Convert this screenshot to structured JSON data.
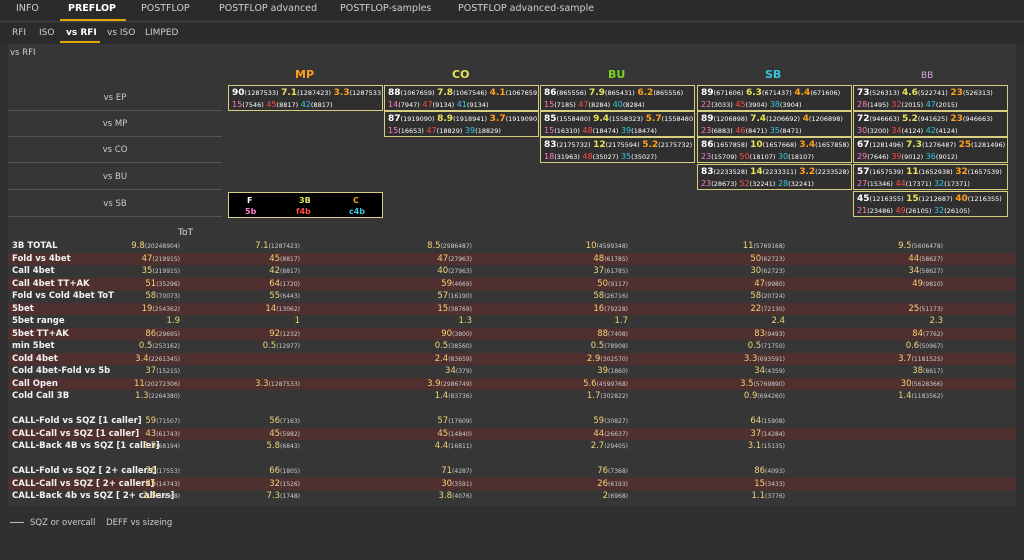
{
  "tabs": [
    "INFO",
    "PREFLOP",
    "POSTFLOP",
    "POSTFLOP advanced",
    "POSTFLOP-samples",
    "POSTFLOP advanced-sample"
  ],
  "active_tab": "PREFLOP",
  "subtabs": [
    "RFI",
    "ISO",
    "vs RFI",
    "vs ISO",
    "LIMPED"
  ],
  "active_subtab": "vs RFI",
  "panel_title": "vs RFI",
  "positions": [
    {
      "label": "MP",
      "color": "#ff9f1a"
    },
    {
      "label": "CO",
      "color": "#e8e35a"
    },
    {
      "label": "BU",
      "color": "#7ed321"
    },
    {
      "label": "SB",
      "color": "#35c6e0"
    },
    {
      "label": "BB",
      "color": "#d9a0e0"
    }
  ],
  "row_labels": [
    "vs EP",
    "vs MP",
    "vs CO",
    "vs BU",
    "vs SB"
  ],
  "matrix": [
    [
      [
        "90",
        "(1287533)",
        "7.1",
        "(1287423)",
        "3.3",
        "(1287533)",
        "15",
        "(7546)",
        "45",
        "(8817)",
        "42",
        "(8817)"
      ],
      [
        "88",
        "(1067659)",
        "7.8",
        "(1067546)",
        "4.1",
        "(1067659)",
        "14",
        "(7947)",
        "47",
        "(9134)",
        "41",
        "(9134)"
      ],
      [
        "86",
        "(865556)",
        "7.9",
        "(865431)",
        "6.2",
        "(865556)",
        "15",
        "(7185)",
        "47",
        "(8284)",
        "40",
        "(8284)"
      ],
      [
        "89",
        "(671606)",
        "6.3",
        "(671437)",
        "4.4",
        "(671606)",
        "22",
        "(3033)",
        "45",
        "(3904)",
        "38",
        "(3904)"
      ],
      [
        "73",
        "(526313)",
        "4.6",
        "(522741)",
        "23",
        "(526313)",
        "28",
        "(1495)",
        "32",
        "(2015)",
        "47",
        "(2015)"
      ]
    ],
    [
      null,
      [
        "87",
        "(1919090)",
        "8.9",
        "(1918941)",
        "3.7",
        "(1919090)",
        "15",
        "(16653)",
        "47",
        "(18829)",
        "39",
        "(18829)"
      ],
      [
        "85",
        "(1558480)",
        "9.4",
        "(1558323)",
        "5.7",
        "(1558480)",
        "15",
        "(16310)",
        "48",
        "(18474)",
        "39",
        "(18474)"
      ],
      [
        "89",
        "(1206898)",
        "7.4",
        "(1206692)",
        "4",
        "(1206898)",
        "23",
        "(6883)",
        "46",
        "(8471)",
        "35",
        "(8471)"
      ],
      [
        "72",
        "(946663)",
        "5.2",
        "(941625)",
        "23",
        "(946663)",
        "30",
        "(3200)",
        "34",
        "(4124)",
        "42",
        "(4124)"
      ]
    ],
    [
      null,
      null,
      [
        "83",
        "(2175732)",
        "12",
        "(2175594)",
        "5.2",
        "(2175732)",
        "18",
        "(31963)",
        "48",
        "(35027)",
        "35",
        "(35027)"
      ],
      [
        "86",
        "(1657858)",
        "10",
        "(1657668)",
        "3.4",
        "(1657858)",
        "23",
        "(15709)",
        "50",
        "(18107)",
        "30",
        "(18107)"
      ],
      [
        "67",
        "(1281496)",
        "7.3",
        "(1276487)",
        "25",
        "(1281496)",
        "29",
        "(7646)",
        "39",
        "(9012)",
        "36",
        "(9012)"
      ]
    ],
    [
      null,
      null,
      null,
      [
        "83",
        "(2233528)",
        "14",
        "(2233311)",
        "3.2",
        "(2233528)",
        "23",
        "(28673)",
        "52",
        "(32241)",
        "28",
        "(32241)"
      ],
      [
        "57",
        "(1657539)",
        "11",
        "(1652938)",
        "32",
        "(1657539)",
        "27",
        "(15346)",
        "44",
        "(17371)",
        "32",
        "(17371)"
      ]
    ],
    [
      null,
      null,
      null,
      null,
      [
        "45",
        "(1216355)",
        "15",
        "(1212687)",
        "40",
        "(1216355)",
        "21",
        "(23486)",
        "49",
        "(26105)",
        "32",
        "(26105)"
      ]
    ]
  ],
  "legend": {
    "f": "F",
    "b3": "3B",
    "c": "C",
    "b5": "5b",
    "f4b": "f4b",
    "c4b": "c4b"
  },
  "tot_label": "ToT",
  "stats": [
    {
      "label": "3B TOTAL",
      "vals": [
        [
          "9.8",
          "(20248904)"
        ],
        [
          "7.1",
          "(1287423)"
        ],
        [
          "8.5",
          "(2986487)"
        ],
        [
          "10",
          "(4599348)"
        ],
        [
          "11",
          "(5769168)"
        ],
        [
          "9.5",
          "(5606478)"
        ]
      ]
    },
    {
      "label": "Fold vs 4bet",
      "vals": [
        [
          "47",
          "(219915)"
        ],
        [
          "45",
          "(8817)"
        ],
        [
          "47",
          "(27963)"
        ],
        [
          "48",
          "(61785)"
        ],
        [
          "50",
          "(62723)"
        ],
        [
          "44",
          "(58627)"
        ]
      ]
    },
    {
      "label": "Call 4bet",
      "vals": [
        [
          "35",
          "(219915)"
        ],
        [
          "42",
          "(8817)"
        ],
        [
          "40",
          "(27963)"
        ],
        [
          "37",
          "(61785)"
        ],
        [
          "30",
          "(62723)"
        ],
        [
          "34",
          "(58627)"
        ]
      ]
    },
    {
      "label": "Call 4bet TT+AK",
      "vals": [
        [
          "51",
          "(35296)"
        ],
        [
          "64",
          "(1720)"
        ],
        [
          "59",
          "(4669)"
        ],
        [
          "50",
          "(9117)"
        ],
        [
          "47",
          "(9980)"
        ],
        [
          "49",
          "(9810)"
        ]
      ]
    },
    {
      "label": "Fold vs Cold 4bet ToT",
      "vals": [
        [
          "58",
          "(70073)"
        ],
        [
          "55",
          "(6443)"
        ],
        [
          "57",
          "(16190)"
        ],
        [
          "58",
          "(26716)"
        ],
        [
          "58",
          "(20724)"
        ],
        null
      ]
    },
    {
      "label": "5bet",
      "vals": [
        [
          "19",
          "(254362)"
        ],
        [
          "14",
          "(13062)"
        ],
        [
          "15",
          "(38769)"
        ],
        [
          "16",
          "(79228)"
        ],
        [
          "22",
          "(72130)"
        ],
        [
          "25",
          "(51173)"
        ]
      ]
    },
    {
      "label": "5bet range",
      "vals": [
        [
          "1.9",
          ""
        ],
        [
          "1",
          ""
        ],
        [
          "1.3",
          ""
        ],
        [
          "1.7",
          ""
        ],
        [
          "2.4",
          ""
        ],
        [
          "2.3",
          ""
        ]
      ]
    },
    {
      "label": "5bet TT+AK",
      "vals": [
        [
          "86",
          "(29695)"
        ],
        [
          "92",
          "(1232)"
        ],
        [
          "90",
          "(3800)"
        ],
        [
          "88",
          "(7408)"
        ],
        [
          "83",
          "(9493)"
        ],
        [
          "84",
          "(7762)"
        ]
      ]
    },
    {
      "label": "min 5bet",
      "vals": [
        [
          "0.5",
          "(253162)"
        ],
        [
          "0.5",
          "(12977)"
        ],
        [
          "0.5",
          "(38560)"
        ],
        [
          "0.5",
          "(78908)"
        ],
        [
          "0.5",
          "(71750)"
        ],
        [
          "0.6",
          "(50967)"
        ]
      ]
    },
    {
      "label": "Cold 4bet",
      "vals": [
        [
          "3.4",
          "(2261345)"
        ],
        null,
        [
          "2.4",
          "(83659)"
        ],
        [
          "2.9",
          "(302570)"
        ],
        [
          "3.3",
          "(693591)"
        ],
        [
          "3.7",
          "(1181525)"
        ]
      ]
    },
    {
      "label": "Cold 4bet-Fold vs 5b",
      "vals": [
        [
          "37",
          "(15215)"
        ],
        null,
        [
          "34",
          "(379)"
        ],
        [
          "39",
          "(1860)"
        ],
        [
          "34",
          "(4359)"
        ],
        [
          "38",
          "(8617)"
        ]
      ]
    },
    {
      "label": "Call Open",
      "vals": [
        [
          "11",
          "(20272306)"
        ],
        [
          "3.3",
          "(1287533)"
        ],
        [
          "3.9",
          "(2986749)"
        ],
        [
          "5.6",
          "(4599768)"
        ],
        [
          "3.5",
          "(5769890)"
        ],
        [
          "30",
          "(5628366)"
        ]
      ]
    },
    {
      "label": "Cold Call 3B",
      "vals": [
        [
          "1.3",
          "(2264380)"
        ],
        null,
        [
          "1.4",
          "(83736)"
        ],
        [
          "1.7",
          "(302822)"
        ],
        [
          "0.9",
          "(694260)"
        ],
        [
          "1.4",
          "(1183562)"
        ]
      ]
    },
    {
      "label": "",
      "vals": [
        null,
        null,
        null,
        null,
        null,
        null
      ]
    },
    {
      "label": "CALL-Fold vs SQZ [1 caller]",
      "vals": [
        [
          "59",
          "(71507)"
        ],
        [
          "56",
          "(7163)"
        ],
        [
          "57",
          "(17609)"
        ],
        [
          "59",
          "(30827)"
        ],
        [
          "64",
          "(15908)"
        ],
        null
      ]
    },
    {
      "label": "CALL-Call vs SQZ [1 caller]",
      "vals": [
        [
          "43",
          "(61743)"
        ],
        [
          "45",
          "(5982)"
        ],
        [
          "45",
          "(14840)"
        ],
        [
          "44",
          "(26637)"
        ],
        [
          "37",
          "(14284)"
        ],
        null
      ]
    },
    {
      "label": "CALL-Back 4B vs SQZ [1 caller]",
      "vals": [
        [
          "3.5",
          "(68194)"
        ],
        [
          "5.8",
          "(6843)"
        ],
        [
          "4.4",
          "(16811)"
        ],
        [
          "2.7",
          "(29405)"
        ],
        [
          "3.1",
          "(15135)"
        ],
        null
      ]
    },
    {
      "label": "",
      "vals": [
        null,
        null,
        null,
        null,
        null,
        null
      ]
    },
    {
      "label": "CALL-Fold vs SQZ [ 2+ callers]",
      "vals": [
        [
          "76",
          "(17553)"
        ],
        [
          "66",
          "(1805)"
        ],
        [
          "71",
          "(4287)"
        ],
        [
          "76",
          "(7368)"
        ],
        [
          "86",
          "(4093)"
        ],
        null
      ]
    },
    {
      "label": "CALL-Call vs SQZ [ 2+ callers]",
      "vals": [
        [
          "25",
          "(14743)"
        ],
        [
          "32",
          "(1526)"
        ],
        [
          "30",
          "(3591)"
        ],
        [
          "26",
          "(6193)"
        ],
        [
          "15",
          "(3433)"
        ],
        null
      ]
    },
    {
      "label": "CALL-Back 4b vs SQZ [ 2+ callers]",
      "vals": [
        [
          "2.8",
          "(16568)"
        ],
        [
          "7.3",
          "(1748)"
        ],
        [
          "3.8",
          "(4076)"
        ],
        [
          "2",
          "(6968)"
        ],
        [
          "1.1",
          "(3776)"
        ],
        null
      ]
    }
  ],
  "footer": {
    "sqz": "SQZ or overcall",
    "deff": "DEFF vs sizeing"
  }
}
